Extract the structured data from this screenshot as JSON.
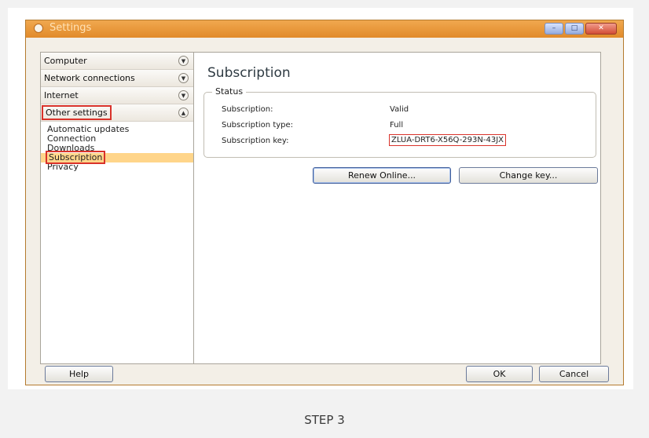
{
  "window": {
    "title": "Settings"
  },
  "sidebar": {
    "sections": [
      {
        "label": "Computer"
      },
      {
        "label": "Network connections"
      },
      {
        "label": "Internet"
      },
      {
        "label": "Other settings"
      }
    ],
    "items": [
      {
        "label": "Automatic updates"
      },
      {
        "label": "Connection"
      },
      {
        "label": "Downloads"
      },
      {
        "label": "Subscription"
      },
      {
        "label": "Privacy"
      }
    ]
  },
  "main": {
    "title": "Subscription",
    "group_label": "Status",
    "rows": [
      {
        "label": "Subscription:",
        "value": "Valid"
      },
      {
        "label": "Subscription type:",
        "value": "Full"
      },
      {
        "label": "Subscription key:",
        "value": "ZLUA-DRT6-X56Q-293N-43JX"
      }
    ],
    "renew_label": "Renew Online...",
    "change_key_label": "Change key..."
  },
  "footer": {
    "help_label": "Help",
    "ok_label": "OK",
    "cancel_label": "Cancel"
  },
  "caption": "STEP 3"
}
